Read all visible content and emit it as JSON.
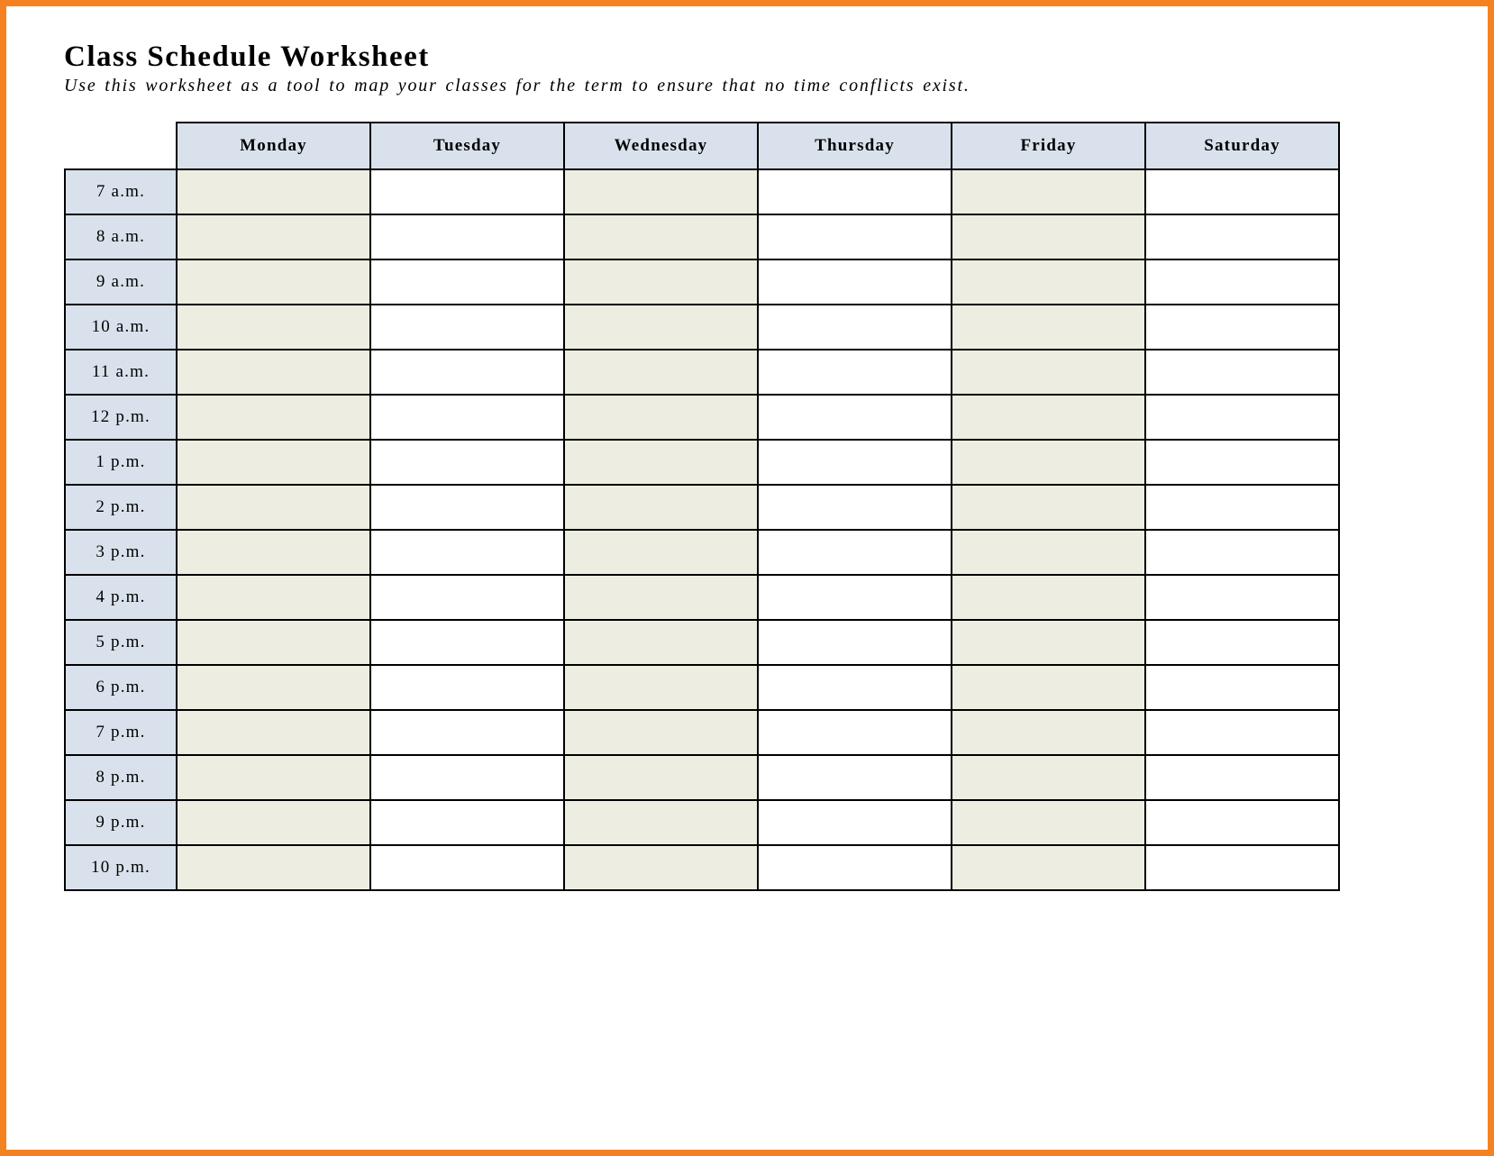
{
  "title": "Class Schedule Worksheet",
  "subtitle": "Use this worksheet as a tool to map your classes for the term to ensure that no time conflicts exist.",
  "days": [
    "Monday",
    "Tuesday",
    "Wednesday",
    "Thursday",
    "Friday",
    "Saturday"
  ],
  "times": [
    "7 a.m.",
    "8 a.m.",
    "9 a.m.",
    "10 a.m.",
    "11 a.m.",
    "12 p.m.",
    "1 p.m.",
    "2 p.m.",
    "3 p.m.",
    "4 p.m.",
    "5 p.m.",
    "6 p.m.",
    "7 p.m.",
    "8 p.m.",
    "9 p.m.",
    "10 p.m."
  ],
  "shaded_day_indices": [
    0,
    2,
    4
  ]
}
